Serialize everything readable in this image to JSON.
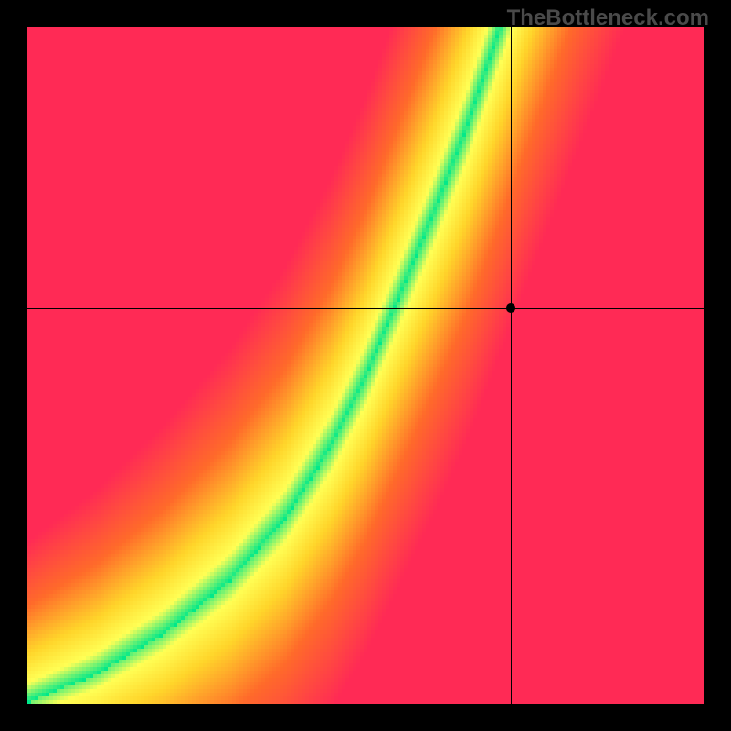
{
  "watermark": "TheBottleneck.com",
  "chart_data": {
    "type": "heatmap",
    "title": "",
    "xlabel": "",
    "ylabel": "",
    "xlim": [
      0,
      1
    ],
    "ylim": [
      0,
      1
    ],
    "grid": false,
    "crosshair": {
      "x": 0.715,
      "y": 0.585
    },
    "marker": {
      "x": 0.715,
      "y": 0.585
    },
    "optimal_curve": {
      "description": "green band center; heat color = distance from this curve (green=on curve, yellow=near, orange/red=far)",
      "points": [
        {
          "x": 0.0,
          "y": 0.0
        },
        {
          "x": 0.1,
          "y": 0.04
        },
        {
          "x": 0.2,
          "y": 0.1
        },
        {
          "x": 0.3,
          "y": 0.18
        },
        {
          "x": 0.38,
          "y": 0.27
        },
        {
          "x": 0.45,
          "y": 0.38
        },
        {
          "x": 0.5,
          "y": 0.48
        },
        {
          "x": 0.55,
          "y": 0.6
        },
        {
          "x": 0.6,
          "y": 0.72
        },
        {
          "x": 0.65,
          "y": 0.85
        },
        {
          "x": 0.7,
          "y": 1.0
        }
      ]
    },
    "resolution": 185,
    "color_stops": [
      {
        "t": 0.0,
        "color": "#ff2a55"
      },
      {
        "t": 0.4,
        "color": "#ff6a2a"
      },
      {
        "t": 0.7,
        "color": "#ffd52a"
      },
      {
        "t": 0.88,
        "color": "#ffff55"
      },
      {
        "t": 1.0,
        "color": "#00e88a"
      }
    ]
  }
}
